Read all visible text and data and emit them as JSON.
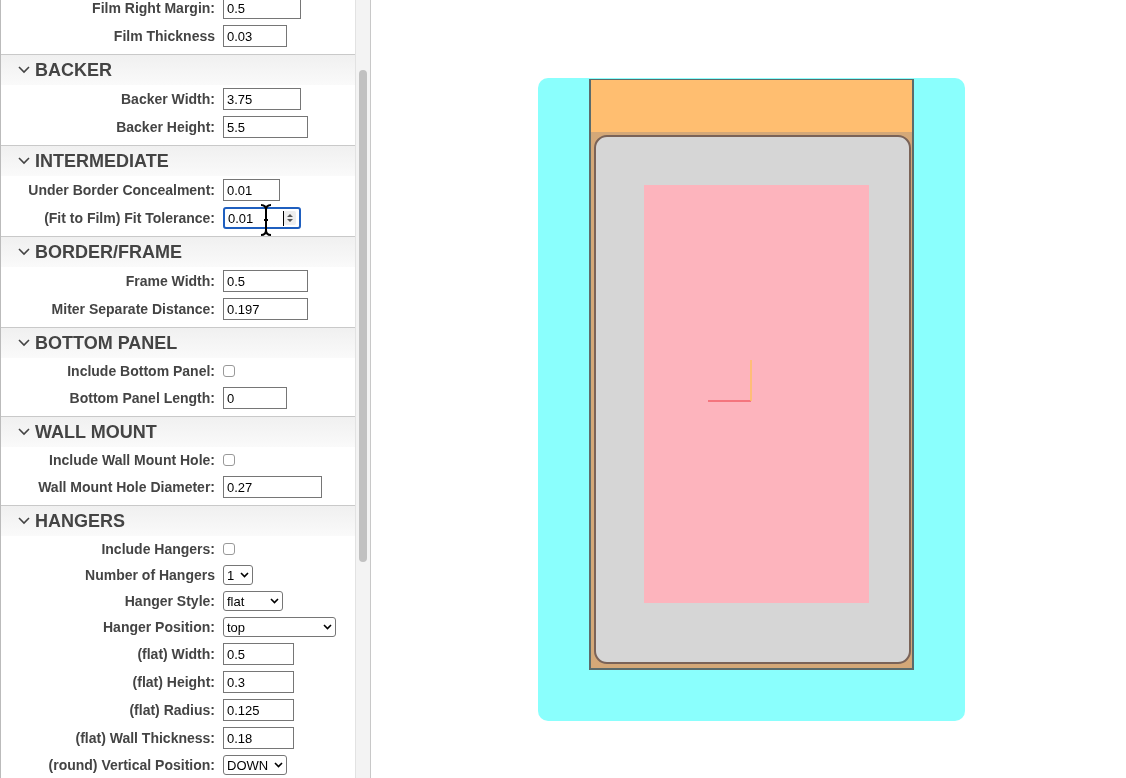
{
  "top_rows": [
    {
      "label": "Film Right Margin:",
      "kind": "number",
      "value": "0.5"
    },
    {
      "label": "Film Thickness",
      "kind": "number",
      "value": "0.03"
    }
  ],
  "sections": [
    {
      "title": "BACKER",
      "expanded": true,
      "rows": [
        {
          "label": "Backer Width:",
          "kind": "number",
          "value": "3.75"
        },
        {
          "label": "Backer Height:",
          "kind": "number",
          "value": "5.5"
        }
      ]
    },
    {
      "title": "INTERMEDIATE",
      "expanded": true,
      "rows": [
        {
          "label": "Under Border Concealment:",
          "kind": "number",
          "value": "0.01"
        },
        {
          "label": "(Fit to Film) Fit Tolerance:",
          "kind": "number",
          "value": "0.01",
          "focused": true
        }
      ]
    },
    {
      "title": "BORDER/FRAME",
      "expanded": true,
      "rows": [
        {
          "label": "Frame Width:",
          "kind": "number",
          "value": "0.5"
        },
        {
          "label": "Miter Separate Distance:",
          "kind": "number",
          "value": "0.197"
        }
      ]
    },
    {
      "title": "BOTTOM PANEL",
      "expanded": true,
      "rows": [
        {
          "label": "Include Bottom Panel:",
          "kind": "checkbox",
          "checked": false
        },
        {
          "label": "Bottom Panel Length:",
          "kind": "number",
          "value": "0"
        }
      ]
    },
    {
      "title": "WALL MOUNT",
      "expanded": true,
      "rows": [
        {
          "label": "Include Wall Mount Hole:",
          "kind": "checkbox",
          "checked": false
        },
        {
          "label": "Wall Mount Hole Diameter:",
          "kind": "number",
          "value": "0.27"
        }
      ]
    },
    {
      "title": "HANGERS",
      "expanded": true,
      "rows": [
        {
          "label": "Include Hangers:",
          "kind": "checkbox",
          "checked": false
        },
        {
          "label": "Number of Hangers",
          "kind": "select",
          "value": "1"
        },
        {
          "label": "Hanger Style:",
          "kind": "select",
          "value": "flat"
        },
        {
          "label": "Hanger Position:",
          "kind": "select",
          "value": "top"
        },
        {
          "label": "(flat) Width:",
          "kind": "number",
          "value": "0.5"
        },
        {
          "label": "(flat) Height:",
          "kind": "number",
          "value": "0.3"
        },
        {
          "label": "(flat) Radius:",
          "kind": "number",
          "value": "0.125"
        },
        {
          "label": "(flat) Wall Thickness:",
          "kind": "number",
          "value": "0.18"
        },
        {
          "label": "(round) Vertical Position:",
          "kind": "select",
          "value": "DOWN"
        }
      ]
    }
  ]
}
